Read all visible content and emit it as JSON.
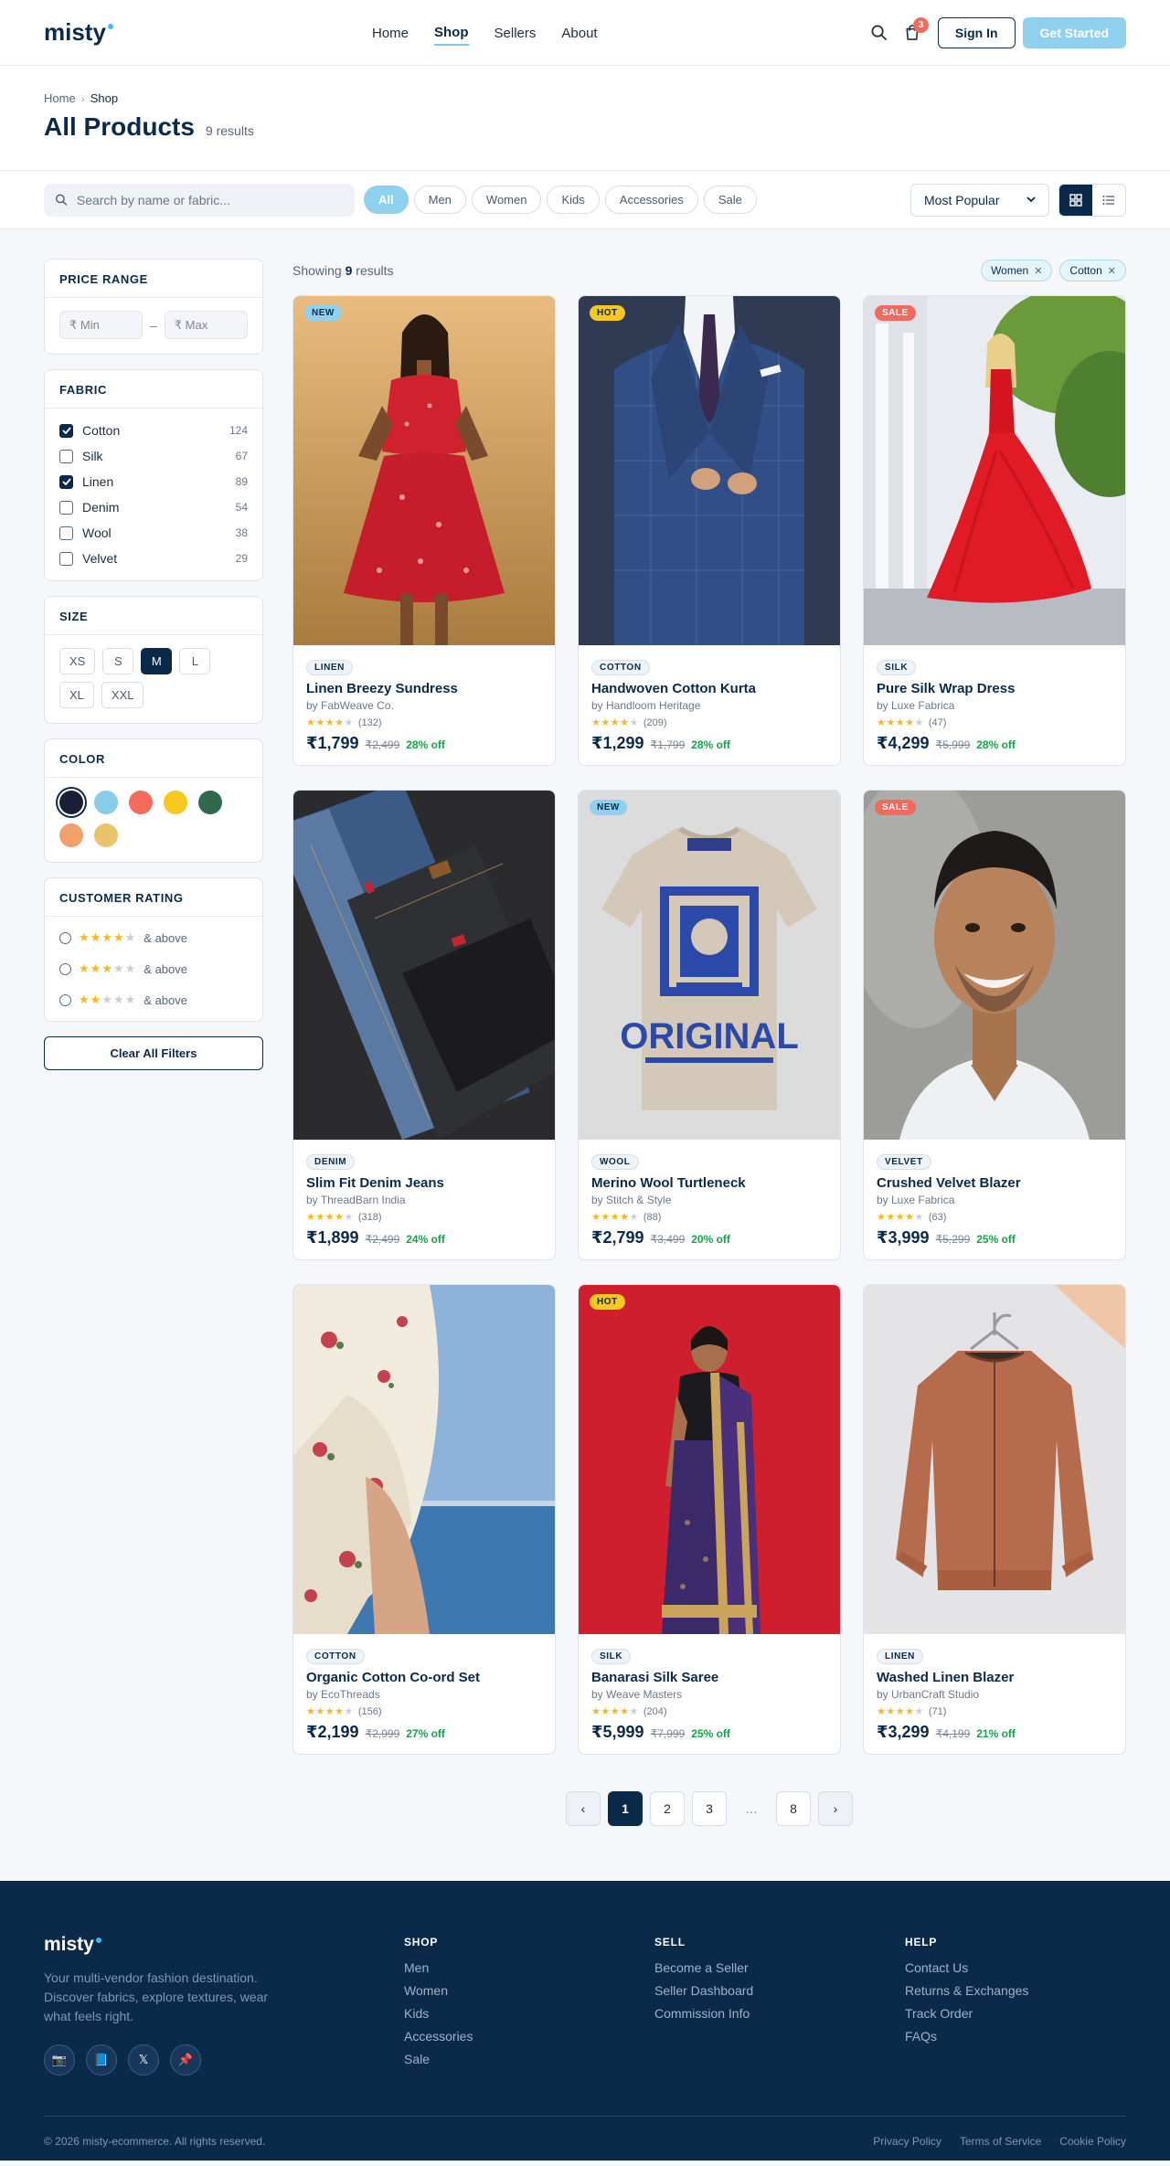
{
  "navbar": {
    "logo": "misty",
    "links": [
      {
        "label": "Home",
        "active": false
      },
      {
        "label": "Shop",
        "active": true
      },
      {
        "label": "Sellers",
        "active": false
      },
      {
        "label": "About",
        "active": false
      }
    ],
    "cart_count": "3",
    "sign_in": "Sign In",
    "get_started": "Get Started"
  },
  "header": {
    "breadcrumb": [
      "Home",
      "Shop"
    ],
    "title": "All Products",
    "result_count": "9 results"
  },
  "filter_bar": {
    "search_placeholder": "Search by name or fabric...",
    "categories": [
      "All",
      "Men",
      "Women",
      "Kids",
      "Accessories",
      "Sale"
    ],
    "active_category": "All",
    "sort_value": "Most Popular",
    "view_mode": "grid"
  },
  "sidebar": {
    "price": {
      "title": "PRICE RANGE",
      "min_placeholder": "₹ Min",
      "max_placeholder": "₹ Max",
      "separator": "–"
    },
    "fabric": {
      "title": "FABRIC",
      "options": [
        {
          "label": "Cotton",
          "count": "124",
          "checked": true
        },
        {
          "label": "Silk",
          "count": "67",
          "checked": false
        },
        {
          "label": "Linen",
          "count": "89",
          "checked": true
        },
        {
          "label": "Denim",
          "count": "54",
          "checked": false
        },
        {
          "label": "Wool",
          "count": "38",
          "checked": false
        },
        {
          "label": "Velvet",
          "count": "29",
          "checked": false
        }
      ]
    },
    "size": {
      "title": "SIZE",
      "options": [
        "XS",
        "S",
        "M",
        "L",
        "XL",
        "XXL"
      ],
      "selected": "M"
    },
    "color": {
      "title": "COLOR",
      "swatches": [
        "#1a1f36",
        "#87cdea",
        "#f26b5b",
        "#f7c81d",
        "#2f6a4f",
        "#f2a06a",
        "#e8c56a"
      ],
      "selected_index": 0
    },
    "rating": {
      "title": "CUSTOMER RATING",
      "options": [
        {
          "stars": 4,
          "label": "& above"
        },
        {
          "stars": 3,
          "label": "& above"
        },
        {
          "stars": 2,
          "label": "& above"
        }
      ]
    },
    "clear_label": "Clear All Filters"
  },
  "content": {
    "showing_prefix": "Showing",
    "showing_count": "9",
    "showing_suffix": "results",
    "active_filters": [
      "Women",
      "Cotton"
    ]
  },
  "products": [
    {
      "badge": "NEW",
      "badge_type": "new",
      "fabric": "LINEN",
      "name": "Linen Breezy Sundress",
      "seller": "by FabWeave Co.",
      "rating": 4,
      "reviews": "(132)",
      "price": "₹1,799",
      "old_price": "₹2,499",
      "discount": "28% off",
      "image": "red-dress-model"
    },
    {
      "badge": "HOT",
      "badge_type": "hot",
      "fabric": "COTTON",
      "name": "Handwoven Cotton Kurta",
      "seller": "by Handloom Heritage",
      "rating": 4,
      "reviews": "(209)",
      "price": "₹1,299",
      "old_price": "₹1,799",
      "discount": "28% off",
      "image": "blue-suit-model"
    },
    {
      "badge": "SALE",
      "badge_type": "sale",
      "fabric": "SILK",
      "name": "Pure Silk Wrap Dress",
      "seller": "by Luxe Fabrica",
      "rating": 4,
      "reviews": "(47)",
      "price": "₹4,299",
      "old_price": "₹5,999",
      "discount": "28% off",
      "image": "red-gown-model"
    },
    {
      "badge": "",
      "badge_type": "",
      "fabric": "DENIM",
      "name": "Slim Fit Denim Jeans",
      "seller": "by ThreadBarn India",
      "rating": 4,
      "reviews": "(318)",
      "price": "₹1,899",
      "old_price": "₹2,499",
      "discount": "24% off",
      "image": "folded-jeans"
    },
    {
      "badge": "NEW",
      "badge_type": "new",
      "fabric": "WOOL",
      "name": "Merino Wool Turtleneck",
      "seller": "by Stitch & Style",
      "rating": 4,
      "reviews": "(88)",
      "price": "₹2,799",
      "old_price": "₹3,499",
      "discount": "20% off",
      "image": "graphic-tshirt"
    },
    {
      "badge": "SALE",
      "badge_type": "sale",
      "fabric": "VELVET",
      "name": "Crushed Velvet Blazer",
      "seller": "by Luxe Fabrica",
      "rating": 4,
      "reviews": "(63)",
      "price": "₹3,999",
      "old_price": "₹5,299",
      "discount": "25% off",
      "image": "smiling-man-portrait"
    },
    {
      "badge": "",
      "badge_type": "",
      "fabric": "COTTON",
      "name": "Organic Cotton Co-ord Set",
      "seller": "by EcoThreads",
      "rating": 4,
      "reviews": "(156)",
      "price": "₹2,199",
      "old_price": "₹2,999",
      "discount": "27% off",
      "image": "floral-dress-seaside"
    },
    {
      "badge": "HOT",
      "badge_type": "hot",
      "fabric": "SILK",
      "name": "Banarasi Silk Saree",
      "seller": "by Weave Masters",
      "rating": 4,
      "reviews": "(204)",
      "price": "₹5,999",
      "old_price": "₹7,999",
      "discount": "25% off",
      "image": "saree-model"
    },
    {
      "badge": "",
      "badge_type": "",
      "fabric": "LINEN",
      "name": "Washed Linen Blazer",
      "seller": "by UrbanCraft Studio",
      "rating": 4,
      "reviews": "(71)",
      "price": "₹3,299",
      "old_price": "₹4,199",
      "discount": "21% off",
      "image": "jacket-on-hanger"
    }
  ],
  "pagination": {
    "prev": "‹",
    "pages": [
      "1",
      "2",
      "3"
    ],
    "ellipsis": "…",
    "last": "8",
    "next": "›",
    "current": "1"
  },
  "footer": {
    "logo": "misty",
    "description": "Your multi-vendor fashion destination. Discover fabrics, explore textures, wear what feels right.",
    "socials": [
      "instagram-icon",
      "facebook-icon",
      "x-icon",
      "pinterest-icon"
    ],
    "columns": [
      {
        "title": "SHOP",
        "links": [
          "Men",
          "Women",
          "Kids",
          "Accessories",
          "Sale"
        ]
      },
      {
        "title": "SELL",
        "links": [
          "Become a Seller",
          "Seller Dashboard",
          "Commission Info"
        ]
      },
      {
        "title": "HELP",
        "links": [
          "Contact Us",
          "Returns & Exchanges",
          "Track Order",
          "FAQs"
        ]
      }
    ],
    "copyright": "© 2026 misty-ecommerce. All rights reserved.",
    "legal": [
      "Privacy Policy",
      "Terms of Service",
      "Cookie Policy"
    ]
  },
  "colors": {
    "primary": "#0b2a4a",
    "accent": "#8fd0ee",
    "star": "#f6b81a",
    "discount": "#16a34a",
    "sale": "#f06a5e",
    "hot": "#f7c81d"
  }
}
